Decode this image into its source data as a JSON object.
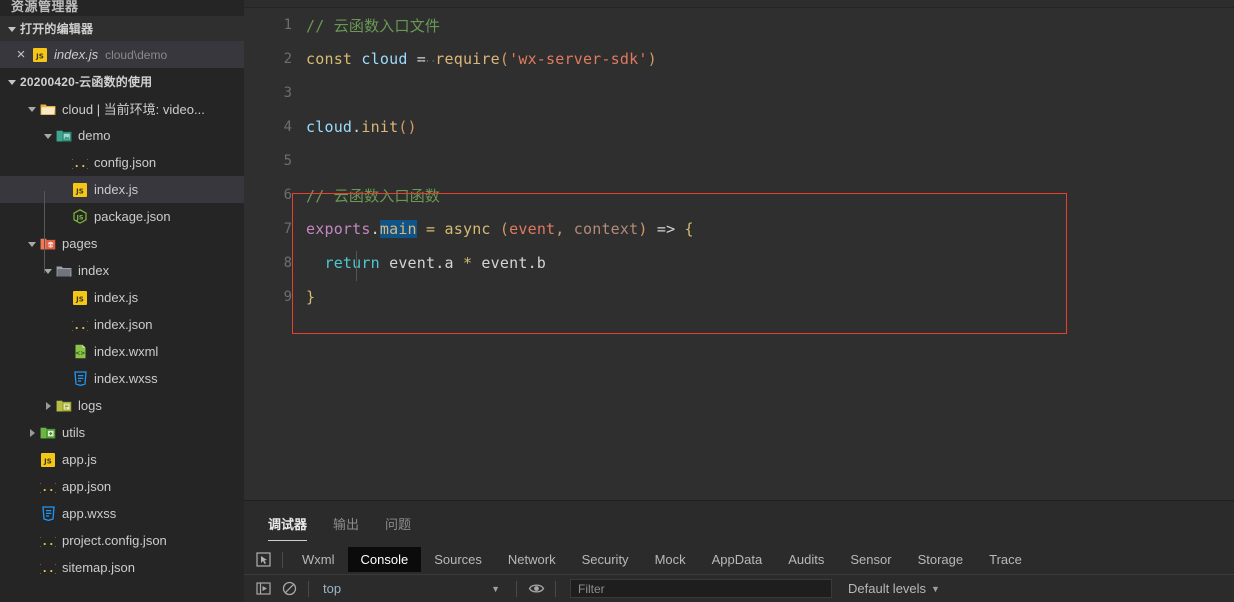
{
  "sidebar": {
    "title": "资源管理器",
    "open_editors": {
      "label": "打开的编辑器",
      "twisty": "chevron-down-icon",
      "items": [
        {
          "close": "×",
          "icon": "js-file-icon",
          "name": "index.js",
          "path": "cloud\\demo",
          "selected": true
        }
      ]
    },
    "project": {
      "label": "20200420-云函数的使用",
      "twisty": "chevron-down-icon"
    },
    "tree": [
      {
        "depth": 1,
        "twisty": "chevron-down-icon",
        "icon": "folder-cloud-icon",
        "label": "cloud | 当前环境: video...",
        "selected": false
      },
      {
        "depth": 2,
        "twisty": "chevron-down-icon",
        "icon": "folder-demo-icon",
        "label": "demo",
        "selected": false
      },
      {
        "depth": 3,
        "twisty": "none",
        "icon": "json-file-icon",
        "label": "config.json",
        "selected": false
      },
      {
        "depth": 3,
        "twisty": "none",
        "icon": "js-file-icon",
        "label": "index.js",
        "selected": true
      },
      {
        "depth": 3,
        "twisty": "none",
        "icon": "nodejs-file-icon",
        "label": "package.json",
        "selected": false
      },
      {
        "depth": 1,
        "twisty": "chevron-down-icon",
        "icon": "folder-pages-icon",
        "label": "pages",
        "selected": false
      },
      {
        "depth": 2,
        "twisty": "chevron-down-icon",
        "icon": "folder-icon",
        "label": "index",
        "selected": false
      },
      {
        "depth": 3,
        "twisty": "none",
        "icon": "js-file-icon",
        "label": "index.js",
        "selected": false
      },
      {
        "depth": 3,
        "twisty": "none",
        "icon": "json-file-icon",
        "label": "index.json",
        "selected": false
      },
      {
        "depth": 3,
        "twisty": "none",
        "icon": "wxml-file-icon",
        "label": "index.wxml",
        "selected": false
      },
      {
        "depth": 3,
        "twisty": "none",
        "icon": "css-file-icon",
        "label": "index.wxss",
        "selected": false
      },
      {
        "depth": 2,
        "twisty": "chevron-right-icon",
        "icon": "folder-logs-icon",
        "label": "logs",
        "selected": false
      },
      {
        "depth": 1,
        "twisty": "chevron-right-icon",
        "icon": "folder-utils-icon",
        "label": "utils",
        "selected": false
      },
      {
        "depth": 1,
        "twisty": "none",
        "icon": "js-file-icon",
        "label": "app.js",
        "selected": false
      },
      {
        "depth": 1,
        "twisty": "none",
        "icon": "json-file-icon",
        "label": "app.json",
        "selected": false
      },
      {
        "depth": 1,
        "twisty": "none",
        "icon": "css-file-icon",
        "label": "app.wxss",
        "selected": false
      },
      {
        "depth": 1,
        "twisty": "none",
        "icon": "json-file-icon",
        "label": "project.config.json",
        "selected": false
      },
      {
        "depth": 1,
        "twisty": "none",
        "icon": "json-file-icon",
        "label": "sitemap.json",
        "selected": false
      }
    ]
  },
  "editor": {
    "file": "index.js",
    "selection": "main",
    "annotation_color": "#e8402a",
    "lines": [
      {
        "n": "1",
        "text": "// 云函数入口文件"
      },
      {
        "n": "2",
        "text": "const cloud = require('wx-server-sdk')"
      },
      {
        "n": "3",
        "text": ""
      },
      {
        "n": "4",
        "text": "cloud.init()"
      },
      {
        "n": "5",
        "text": ""
      },
      {
        "n": "6",
        "text": "// 云函数入口函数"
      },
      {
        "n": "7",
        "text": "exports.main = async (event, context) => {"
      },
      {
        "n": "8",
        "text": "  return event.a * event.b"
      },
      {
        "n": "9",
        "text": "}"
      }
    ]
  },
  "panel": {
    "tabs": [
      {
        "label": "调试器",
        "active": true
      },
      {
        "label": "输出",
        "active": false
      },
      {
        "label": "问题",
        "active": false
      }
    ],
    "devtools_tabs": [
      {
        "label": "Wxml",
        "active": false
      },
      {
        "label": "Console",
        "active": true
      },
      {
        "label": "Sources",
        "active": false
      },
      {
        "label": "Network",
        "active": false
      },
      {
        "label": "Security",
        "active": false
      },
      {
        "label": "Mock",
        "active": false
      },
      {
        "label": "AppData",
        "active": false
      },
      {
        "label": "Audits",
        "active": false
      },
      {
        "label": "Sensor",
        "active": false
      },
      {
        "label": "Storage",
        "active": false
      },
      {
        "label": "Trace",
        "active": false
      }
    ],
    "console_toolbar": {
      "inspect_icon": "inspect-element-icon",
      "execute_icon": "execute-icon",
      "clear_icon": "clear-console-icon",
      "context_value": "top",
      "context_caret": "▼",
      "eye_icon": "live-expression-eye-icon",
      "filter_placeholder": "Filter",
      "filter_value": "",
      "levels_label": "Default levels",
      "levels_caret": "▼"
    }
  }
}
